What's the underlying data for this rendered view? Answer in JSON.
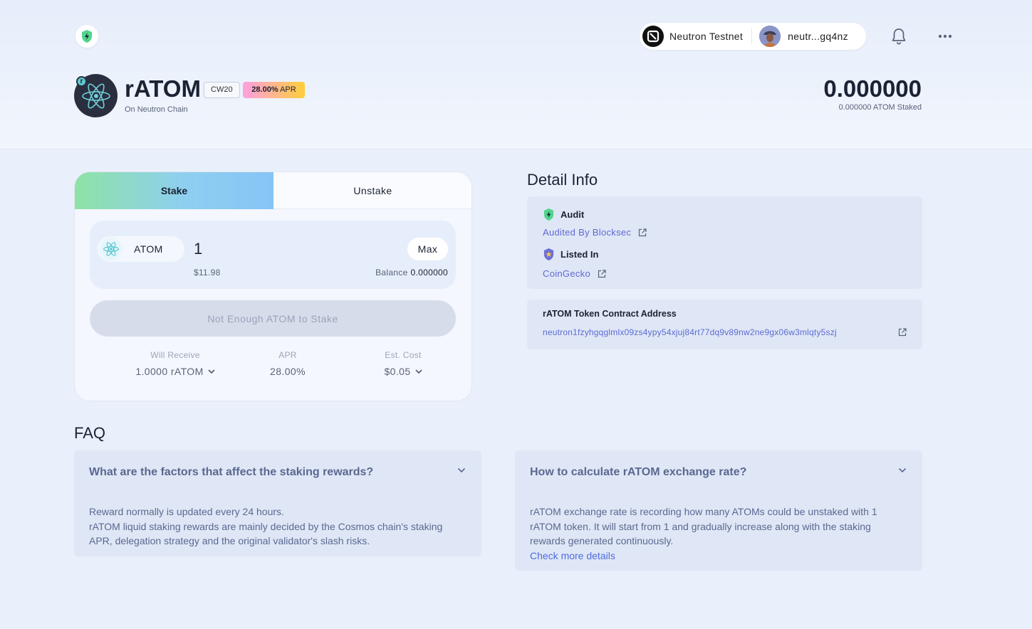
{
  "header": {
    "network_name": "Neutron Testnet",
    "wallet_address": "neutr...gq4nz"
  },
  "token": {
    "name": "rATOM",
    "badge_letter": "r",
    "chain": "On Neutron Chain",
    "standard_tag": "CW20",
    "apr_value": "28.00%",
    "apr_label": "APR",
    "staked_value": "0.000000",
    "staked_sub": "0.000000 ATOM Staked"
  },
  "stake_card": {
    "tabs": [
      {
        "label": "Stake",
        "active": true
      },
      {
        "label": "Unstake",
        "active": false
      }
    ],
    "input_token": "ATOM",
    "amount": "1",
    "max_label": "Max",
    "usd_value": "$11.98",
    "balance_label": "Balance",
    "balance_value": "0.000000",
    "action_label": "Not Enough ATOM to Stake",
    "stats": [
      {
        "label": "Will Receive",
        "value": "1.0000 rATOM",
        "has_dropdown": true
      },
      {
        "label": "APR",
        "value": "28.00%",
        "has_dropdown": false
      },
      {
        "label": "Est. Cost",
        "value": "$0.05",
        "has_dropdown": true
      }
    ]
  },
  "detail_info": {
    "title": "Detail Info",
    "audit_heading": "Audit",
    "audit_link": "Audited By Blocksec",
    "listed_heading": "Listed In",
    "listed_link": "CoinGecko",
    "contract_heading": "rATOM Token Contract Address",
    "contract_address": "neutron1fzyhgqglmlx09zs4ypy54xjuj84rt77dq9v89nw2ne9gx06w3mlqty5szj"
  },
  "faq": {
    "title": "FAQ",
    "items": [
      {
        "question": "What are the factors that affect the staking rewards?",
        "answer_lines": [
          "Reward normally is updated every 24 hours.",
          "rATOM liquid staking rewards are mainly decided by the Cosmos chain's staking APR, delegation strategy and the original validator's slash risks."
        ]
      },
      {
        "question": "How to calculate rATOM exchange rate?",
        "answer_lines": [
          "rATOM exchange rate is recording how many ATOMs could be unstaked with 1 rATOM token. It will start from 1 and gradually increase along with the staking rewards generated continuously."
        ],
        "link": "Check more details"
      }
    ]
  },
  "colors": {
    "background": "#e9f0fb",
    "accent_link": "#5e6ad2",
    "stake_tab_gradient_start": "#8ee2a6",
    "stake_tab_gradient_end": "#86c4f6",
    "apr_gradient_start": "#ff9fe0",
    "apr_gradient_end": "#ffce3a"
  },
  "icons": {
    "app_logo": "shield-bolt-icon",
    "network": "neutron-icon",
    "notifications": "bell-icon",
    "more": "more-dots-icon",
    "token": "cosmos-atom-icon",
    "audit": "shield-bolt-icon",
    "listed": "shield-star-icon",
    "external": "external-link-icon",
    "dropdown": "chevron-down-icon"
  }
}
